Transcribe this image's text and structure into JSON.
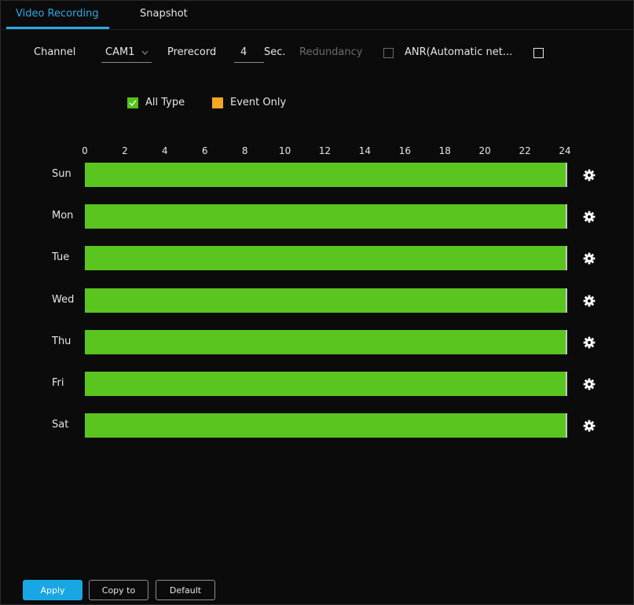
{
  "tabs": [
    {
      "label": "Video Recording",
      "active": true
    },
    {
      "label": "Snapshot",
      "active": false
    }
  ],
  "toolbar": {
    "channel_label": "Channel",
    "channel_value": "CAM1",
    "prerecord_label": "Prerecord",
    "prerecord_value": "4",
    "prerecord_unit": "Sec.",
    "redundancy_label": "Redundancy",
    "redundancy_checked": false,
    "anr_label": "ANR(Automatic net...",
    "anr_checked": false
  },
  "legend": {
    "all_type": "All Type",
    "event_only": "Event Only",
    "all_type_color": "#52c41a",
    "event_only_color": "#f5a524"
  },
  "schedule": {
    "hour_ticks": [
      "0",
      "2",
      "4",
      "6",
      "8",
      "10",
      "12",
      "14",
      "16",
      "18",
      "20",
      "22",
      "24"
    ],
    "days": [
      {
        "label": "Sun",
        "coverage": 1.0
      },
      {
        "label": "Mon",
        "coverage": 1.0
      },
      {
        "label": "Tue",
        "coverage": 1.0
      },
      {
        "label": "Wed",
        "coverage": 1.0
      },
      {
        "label": "Thu",
        "coverage": 1.0
      },
      {
        "label": "Fri",
        "coverage": 1.0
      },
      {
        "label": "Sat",
        "coverage": 1.0
      }
    ],
    "bar_color": "#5ac51f"
  },
  "buttons": {
    "apply": "Apply",
    "copy_to": "Copy to",
    "default": "Default"
  },
  "icons": {
    "gear": "gear-icon",
    "dropdown": "chevron-down-icon",
    "check": "check-icon"
  }
}
